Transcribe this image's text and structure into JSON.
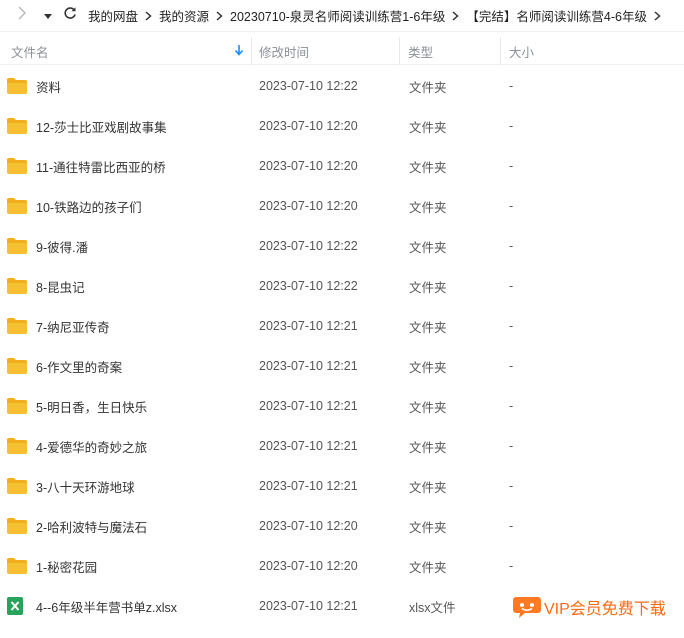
{
  "toolbar": {
    "breadcrumbs": [
      "我的网盘",
      "我的资源",
      "20230710-泉灵名师阅读训练营1-6年级",
      "【完结】名师阅读训练营4-6年级"
    ]
  },
  "header": {
    "name_label": "文件名",
    "time_label": "修改时间",
    "type_label": "类型",
    "size_label": "大小"
  },
  "rows": [
    {
      "name": "资料",
      "time": "2023-07-10 12:22",
      "type": "文件夹",
      "size": "-",
      "icon": "folder-icon"
    },
    {
      "name": "12-莎士比亚戏剧故事集",
      "time": "2023-07-10 12:20",
      "type": "文件夹",
      "size": "-",
      "icon": "folder-icon"
    },
    {
      "name": "11-通往特雷比西亚的桥",
      "time": "2023-07-10 12:20",
      "type": "文件夹",
      "size": "-",
      "icon": "folder-icon"
    },
    {
      "name": "10-铁路边的孩子们",
      "time": "2023-07-10 12:20",
      "type": "文件夹",
      "size": "-",
      "icon": "folder-icon"
    },
    {
      "name": "9-彼得.潘",
      "time": "2023-07-10 12:22",
      "type": "文件夹",
      "size": "-",
      "icon": "folder-icon"
    },
    {
      "name": "8-昆虫记",
      "time": "2023-07-10 12:22",
      "type": "文件夹",
      "size": "-",
      "icon": "folder-icon"
    },
    {
      "name": "7-纳尼亚传奇",
      "time": "2023-07-10 12:21",
      "type": "文件夹",
      "size": "-",
      "icon": "folder-icon"
    },
    {
      "name": "6-作文里的奇案",
      "time": "2023-07-10 12:21",
      "type": "文件夹",
      "size": "-",
      "icon": "folder-icon"
    },
    {
      "name": "5-明日香，生日快乐",
      "time": "2023-07-10 12:21",
      "type": "文件夹",
      "size": "-",
      "icon": "folder-icon"
    },
    {
      "name": "4-爱德华的奇妙之旅",
      "time": "2023-07-10 12:21",
      "type": "文件夹",
      "size": "-",
      "icon": "folder-icon"
    },
    {
      "name": "3-八十天环游地球",
      "time": "2023-07-10 12:21",
      "type": "文件夹",
      "size": "-",
      "icon": "folder-icon"
    },
    {
      "name": "2-哈利波特与魔法石",
      "time": "2023-07-10 12:20",
      "type": "文件夹",
      "size": "-",
      "icon": "folder-icon"
    },
    {
      "name": "1-秘密花园",
      "time": "2023-07-10 12:20",
      "type": "文件夹",
      "size": "-",
      "icon": "folder-icon"
    },
    {
      "name": "4--6年级半年营书单z.xlsx",
      "time": "2023-07-10 12:21",
      "type": "xlsx文件",
      "size": "",
      "icon": "excel-file-icon"
    }
  ],
  "promo": {
    "label": "VIP会员免费下载"
  },
  "colors": {
    "folder": "#f7c033",
    "folder_tab": "#f0ae1d",
    "excel": "#27a35c",
    "accent": "#1a8cff",
    "promo": "#ff6a13"
  }
}
